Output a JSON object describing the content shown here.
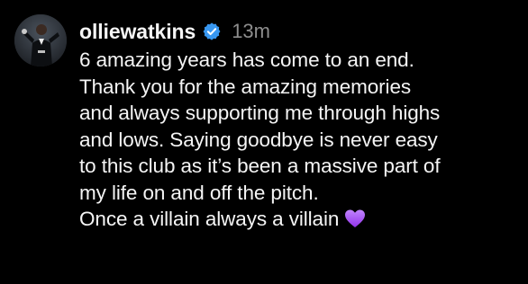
{
  "post": {
    "username": "olliewatkins",
    "timestamp": "13m",
    "avatar_icon": "profile-photo",
    "verified_icon": "verified-badge-icon",
    "verified_color": "#3897f0",
    "lines": [
      "6 amazing years has come to an end.",
      "Thank you for the amazing memories",
      "and always supporting me through highs",
      "and lows. Saying goodbye is never easy",
      "to this club as it’s been a massive part of",
      "my life on and off the pitch.",
      "Once a villain always a villain"
    ],
    "emoji": "purple-heart",
    "emoji_color": "#a855f7"
  },
  "colors": {
    "background": "#000000",
    "text": "#f5f5f5",
    "muted": "#8e8e8e"
  }
}
